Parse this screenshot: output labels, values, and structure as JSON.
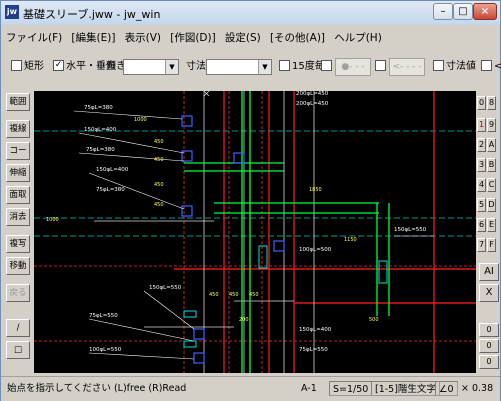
{
  "window": {
    "title": "基礎スリーブ.jww - jw_win",
    "app_icon_text": "jw"
  },
  "window_buttons": {
    "minimize": "–",
    "maximize": "□",
    "close": "×"
  },
  "menu": [
    "ファイル(F)",
    "[編集(E)]",
    "表示(V)",
    "[作図(D)]",
    "設定(S)",
    "[その他(A)]",
    "ヘルプ(H)"
  ],
  "toolbar": {
    "rect_label": "矩形",
    "rect_checked": false,
    "hv_label": "水平・垂直",
    "hv_checked": true,
    "tilt_label": "傾き",
    "dim_label": "寸法",
    "deg15_label": "15度毎",
    "deg15_checked": false,
    "dot_btn": "●- - -",
    "arrow_btn": "<- - - -",
    "dimval_label": "寸法値",
    "lt_label": "<"
  },
  "left_tools": [
    "範囲",
    "複線",
    "コーナー",
    "伸縮",
    "面取",
    "消去",
    "複写",
    "移動",
    "戻る"
  ],
  "left_tools_disabled": [
    "戻る"
  ],
  "left_lower": {
    "line_icon": "/",
    "rect_icon": "□"
  },
  "layer_groups": {
    "col1": [
      "0",
      "1",
      "2",
      "3",
      "4",
      "5",
      "6",
      "7"
    ],
    "col2": [
      "8",
      "9",
      "A",
      "B",
      "C",
      "D",
      "E",
      "F"
    ],
    "active": "1"
  },
  "right_big": {
    "all_label": "AI",
    "x_label": "X"
  },
  "right_lower": {
    "btn1": "0",
    "btn2": "0",
    "btn3": "0"
  },
  "status": {
    "message": "始点を指示してください (L)free (R)Read",
    "scale_a": "A-1",
    "scale": "S=1/50",
    "layer": "[1-5]階生文字",
    "angle": "∠0",
    "zoom": "× 0.38"
  },
  "drawing": {
    "labels": [
      "75φL=380",
      "150φL=400",
      "75φL=380",
      "150φL=400",
      "75φL=380",
      "150φL=550",
      "75φL=550",
      "100φL=550",
      "200φL=450",
      "200φL=450",
      "150φL=550",
      "100φL=500",
      "150φL=400",
      "75φL=550"
    ],
    "dims": [
      "1000",
      "450",
      "450",
      "450",
      "450",
      "450",
      "450",
      "450",
      "500",
      "1850",
      "1150",
      "200",
      "1000"
    ]
  }
}
